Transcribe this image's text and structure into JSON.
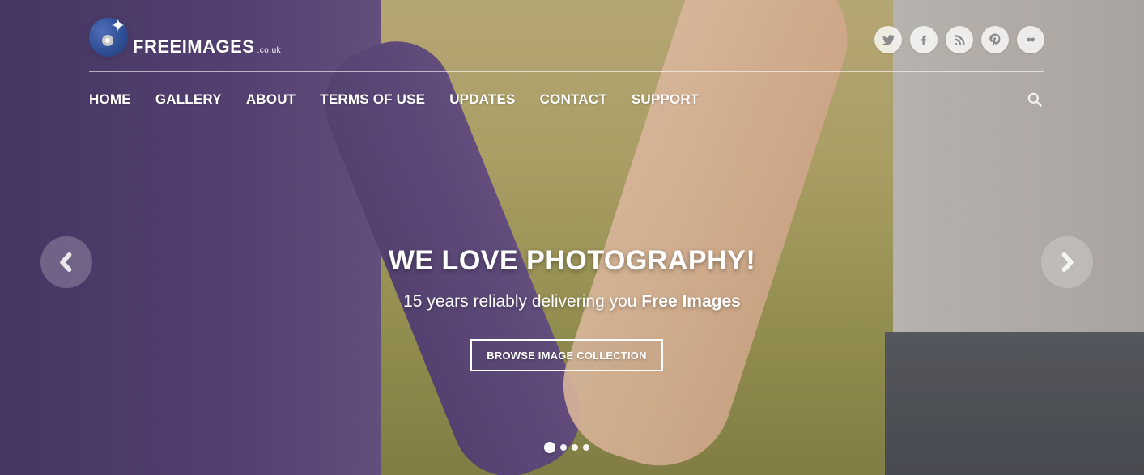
{
  "brand": {
    "name_main": "FREE",
    "name_bold": "IMAGES",
    "suffix": ".co.uk"
  },
  "social": [
    {
      "name": "twitter",
      "icon": "twitter-icon"
    },
    {
      "name": "facebook",
      "icon": "facebook-icon"
    },
    {
      "name": "rss",
      "icon": "rss-icon"
    },
    {
      "name": "pinterest",
      "icon": "pinterest-icon"
    },
    {
      "name": "flickr",
      "icon": "flickr-icon"
    }
  ],
  "nav": {
    "items": [
      "HOME",
      "GALLERY",
      "ABOUT",
      "TERMS OF USE",
      "UPDATES",
      "CONTACT",
      "SUPPORT"
    ],
    "search_icon": "search-icon"
  },
  "hero": {
    "headline": "WE LOVE PHOTOGRAPHY!",
    "sub_prefix": "15 years reliably delivering you ",
    "sub_strong": "Free Images",
    "cta": "BROWSE IMAGE COLLECTION"
  },
  "carousel": {
    "slides": 4,
    "active_index": 0,
    "prev_icon": "chevron-left-icon",
    "next_icon": "chevron-right-icon"
  }
}
